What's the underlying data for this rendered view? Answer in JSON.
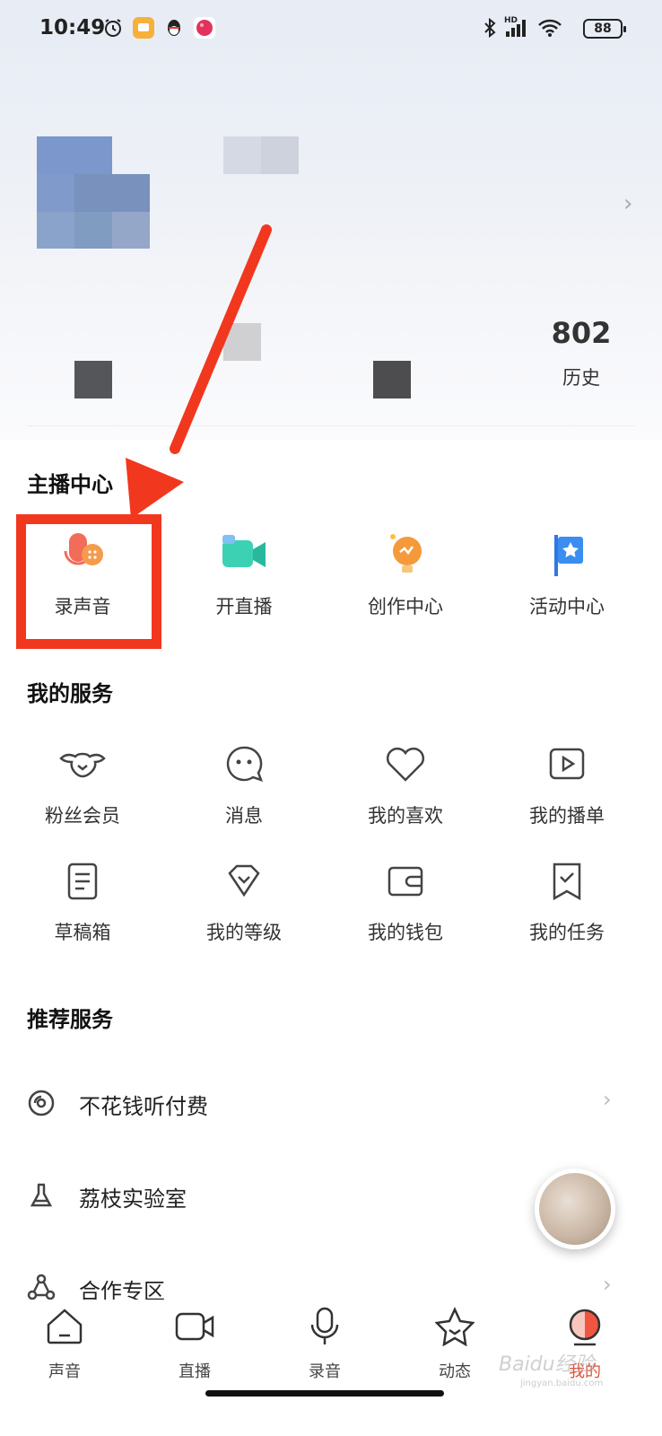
{
  "status_bar": {
    "time": "10:49",
    "battery": "88",
    "network": "HD"
  },
  "profile": {
    "history_count": "802",
    "history_label": "历史"
  },
  "anchor_center": {
    "title": "主播中心",
    "items": [
      {
        "label": "录声音",
        "icon": "record-voice-icon"
      },
      {
        "label": "开直播",
        "icon": "live-camera-icon"
      },
      {
        "label": "创作中心",
        "icon": "creation-bulb-icon"
      },
      {
        "label": "活动中心",
        "icon": "activity-flag-icon"
      }
    ]
  },
  "my_services": {
    "title": "我的服务",
    "items": [
      {
        "label": "粉丝会员",
        "icon": "fan-member-icon"
      },
      {
        "label": "消息",
        "icon": "message-icon"
      },
      {
        "label": "我的喜欢",
        "icon": "heart-icon"
      },
      {
        "label": "我的播单",
        "icon": "playlist-icon"
      },
      {
        "label": "草稿箱",
        "icon": "draft-icon"
      },
      {
        "label": "我的等级",
        "icon": "level-icon"
      },
      {
        "label": "我的钱包",
        "icon": "wallet-icon"
      },
      {
        "label": "我的任务",
        "icon": "task-icon"
      }
    ]
  },
  "recommended": {
    "title": "推荐服务",
    "items": [
      {
        "label": "不花钱听付费",
        "icon": "free-listen-icon"
      },
      {
        "label": "荔枝实验室",
        "icon": "flask-icon"
      },
      {
        "label": "合作专区",
        "icon": "cooperation-icon"
      }
    ]
  },
  "bottom_nav": {
    "items": [
      {
        "label": "声音",
        "icon": "home-icon"
      },
      {
        "label": "直播",
        "icon": "video-icon"
      },
      {
        "label": "录音",
        "icon": "microphone-icon"
      },
      {
        "label": "动态",
        "icon": "star-icon"
      },
      {
        "label": "我的",
        "icon": "me-icon"
      }
    ],
    "active_index": 4
  },
  "colors": {
    "accent": "#f2371f",
    "active_tab": "#e0503a"
  },
  "watermark": {
    "text": "Baidu经验",
    "url": "jingyan.baidu.com"
  }
}
